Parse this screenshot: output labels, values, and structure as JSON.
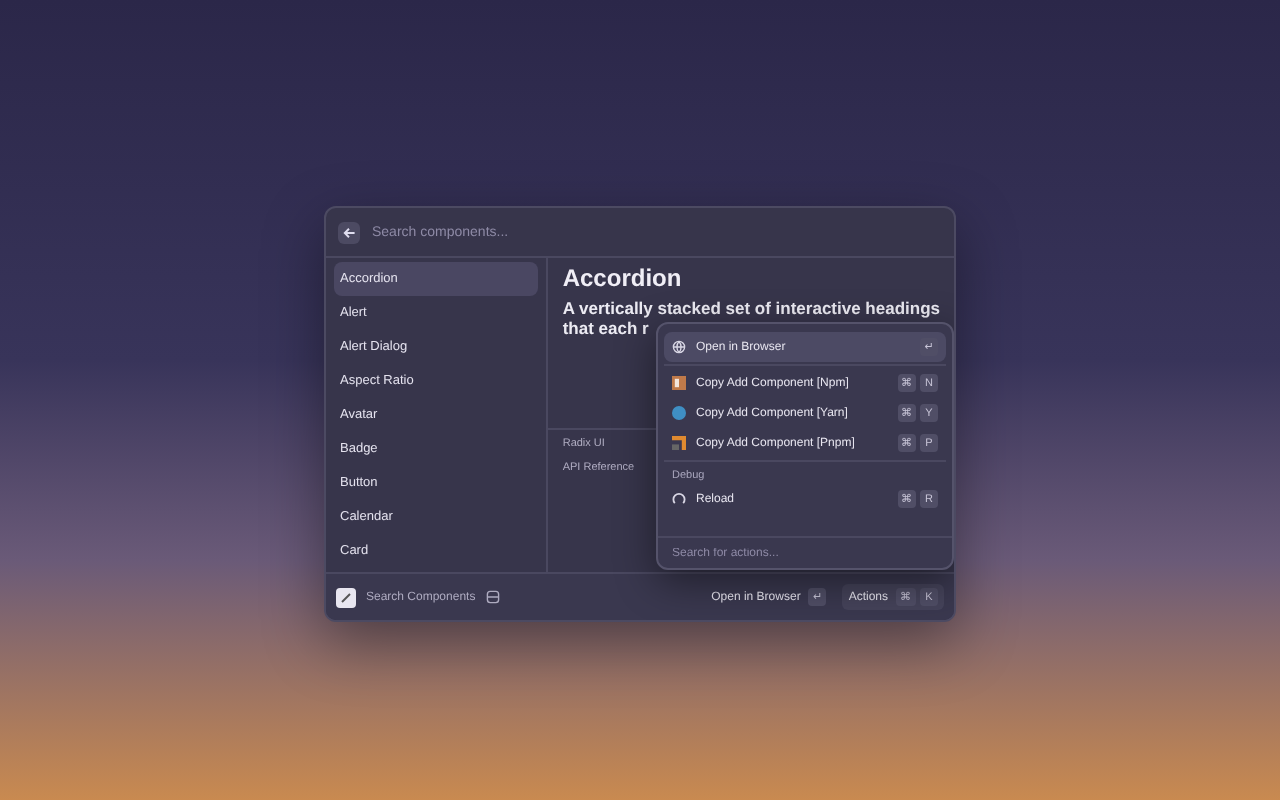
{
  "search": {
    "placeholder": "Search components..."
  },
  "sidebar": {
    "items": [
      {
        "label": "Accordion",
        "selected": true
      },
      {
        "label": "Alert",
        "selected": false
      },
      {
        "label": "Alert Dialog",
        "selected": false
      },
      {
        "label": "Aspect Ratio",
        "selected": false
      },
      {
        "label": "Avatar",
        "selected": false
      },
      {
        "label": "Badge",
        "selected": false
      },
      {
        "label": "Button",
        "selected": false
      },
      {
        "label": "Calendar",
        "selected": false
      },
      {
        "label": "Card",
        "selected": false
      }
    ]
  },
  "detail": {
    "title": "Accordion",
    "description_lines": [
      "A vertically stacked set of interactive headings",
      "that each r"
    ],
    "metadata": [
      "Radix UI",
      "API Reference"
    ]
  },
  "actions_menu": {
    "sections": [
      {
        "items": [
          {
            "label": "Open in Browser",
            "kind": "globe",
            "keys": [
              "↵"
            ],
            "selected": true
          }
        ]
      },
      {
        "items": [
          {
            "label": "Copy Add Component [Npm]",
            "kind": "npm",
            "keys": [
              "⌘",
              "N"
            ],
            "selected": false
          },
          {
            "label": "Copy Add Component [Yarn]",
            "kind": "yarn",
            "keys": [
              "⌘",
              "Y"
            ],
            "selected": false
          },
          {
            "label": "Copy Add Component [Pnpm]",
            "kind": "pnpm",
            "keys": [
              "⌘",
              "P"
            ],
            "selected": false
          }
        ]
      },
      {
        "title": "Debug",
        "items": [
          {
            "label": "Reload",
            "kind": "reload",
            "keys": [
              "⌘",
              "R"
            ],
            "selected": false
          }
        ]
      }
    ],
    "search_placeholder": "Search for actions..."
  },
  "footer": {
    "title": "Search Components",
    "primary_action": "Open in Browser",
    "primary_key": "↵",
    "actions_label": "Actions",
    "actions_keys": [
      "⌘",
      "K"
    ]
  }
}
